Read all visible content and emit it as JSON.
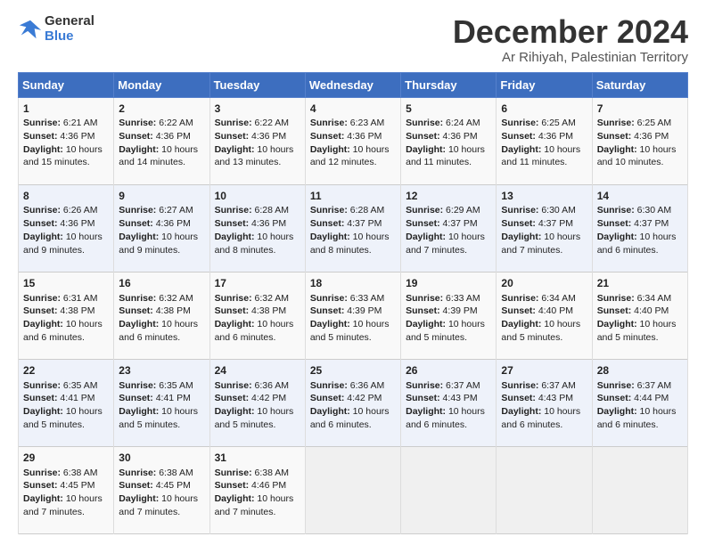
{
  "header": {
    "logo_line1": "General",
    "logo_line2": "Blue",
    "title": "December 2024",
    "subtitle": "Ar Rihiyah, Palestinian Territory"
  },
  "days_of_week": [
    "Sunday",
    "Monday",
    "Tuesday",
    "Wednesday",
    "Thursday",
    "Friday",
    "Saturday"
  ],
  "weeks": [
    [
      {
        "day": 1,
        "sunrise": "6:21 AM",
        "sunset": "4:36 PM",
        "daylight": "10 hours and 15 minutes."
      },
      {
        "day": 2,
        "sunrise": "6:22 AM",
        "sunset": "4:36 PM",
        "daylight": "10 hours and 14 minutes."
      },
      {
        "day": 3,
        "sunrise": "6:22 AM",
        "sunset": "4:36 PM",
        "daylight": "10 hours and 13 minutes."
      },
      {
        "day": 4,
        "sunrise": "6:23 AM",
        "sunset": "4:36 PM",
        "daylight": "10 hours and 12 minutes."
      },
      {
        "day": 5,
        "sunrise": "6:24 AM",
        "sunset": "4:36 PM",
        "daylight": "10 hours and 11 minutes."
      },
      {
        "day": 6,
        "sunrise": "6:25 AM",
        "sunset": "4:36 PM",
        "daylight": "10 hours and 11 minutes."
      },
      {
        "day": 7,
        "sunrise": "6:25 AM",
        "sunset": "4:36 PM",
        "daylight": "10 hours and 10 minutes."
      }
    ],
    [
      {
        "day": 8,
        "sunrise": "6:26 AM",
        "sunset": "4:36 PM",
        "daylight": "10 hours and 9 minutes."
      },
      {
        "day": 9,
        "sunrise": "6:27 AM",
        "sunset": "4:36 PM",
        "daylight": "10 hours and 9 minutes."
      },
      {
        "day": 10,
        "sunrise": "6:28 AM",
        "sunset": "4:36 PM",
        "daylight": "10 hours and 8 minutes."
      },
      {
        "day": 11,
        "sunrise": "6:28 AM",
        "sunset": "4:37 PM",
        "daylight": "10 hours and 8 minutes."
      },
      {
        "day": 12,
        "sunrise": "6:29 AM",
        "sunset": "4:37 PM",
        "daylight": "10 hours and 7 minutes."
      },
      {
        "day": 13,
        "sunrise": "6:30 AM",
        "sunset": "4:37 PM",
        "daylight": "10 hours and 7 minutes."
      },
      {
        "day": 14,
        "sunrise": "6:30 AM",
        "sunset": "4:37 PM",
        "daylight": "10 hours and 6 minutes."
      }
    ],
    [
      {
        "day": 15,
        "sunrise": "6:31 AM",
        "sunset": "4:38 PM",
        "daylight": "10 hours and 6 minutes."
      },
      {
        "day": 16,
        "sunrise": "6:32 AM",
        "sunset": "4:38 PM",
        "daylight": "10 hours and 6 minutes."
      },
      {
        "day": 17,
        "sunrise": "6:32 AM",
        "sunset": "4:38 PM",
        "daylight": "10 hours and 6 minutes."
      },
      {
        "day": 18,
        "sunrise": "6:33 AM",
        "sunset": "4:39 PM",
        "daylight": "10 hours and 5 minutes."
      },
      {
        "day": 19,
        "sunrise": "6:33 AM",
        "sunset": "4:39 PM",
        "daylight": "10 hours and 5 minutes."
      },
      {
        "day": 20,
        "sunrise": "6:34 AM",
        "sunset": "4:40 PM",
        "daylight": "10 hours and 5 minutes."
      },
      {
        "day": 21,
        "sunrise": "6:34 AM",
        "sunset": "4:40 PM",
        "daylight": "10 hours and 5 minutes."
      }
    ],
    [
      {
        "day": 22,
        "sunrise": "6:35 AM",
        "sunset": "4:41 PM",
        "daylight": "10 hours and 5 minutes."
      },
      {
        "day": 23,
        "sunrise": "6:35 AM",
        "sunset": "4:41 PM",
        "daylight": "10 hours and 5 minutes."
      },
      {
        "day": 24,
        "sunrise": "6:36 AM",
        "sunset": "4:42 PM",
        "daylight": "10 hours and 5 minutes."
      },
      {
        "day": 25,
        "sunrise": "6:36 AM",
        "sunset": "4:42 PM",
        "daylight": "10 hours and 6 minutes."
      },
      {
        "day": 26,
        "sunrise": "6:37 AM",
        "sunset": "4:43 PM",
        "daylight": "10 hours and 6 minutes."
      },
      {
        "day": 27,
        "sunrise": "6:37 AM",
        "sunset": "4:43 PM",
        "daylight": "10 hours and 6 minutes."
      },
      {
        "day": 28,
        "sunrise": "6:37 AM",
        "sunset": "4:44 PM",
        "daylight": "10 hours and 6 minutes."
      }
    ],
    [
      {
        "day": 29,
        "sunrise": "6:38 AM",
        "sunset": "4:45 PM",
        "daylight": "10 hours and 7 minutes."
      },
      {
        "day": 30,
        "sunrise": "6:38 AM",
        "sunset": "4:45 PM",
        "daylight": "10 hours and 7 minutes."
      },
      {
        "day": 31,
        "sunrise": "6:38 AM",
        "sunset": "4:46 PM",
        "daylight": "10 hours and 7 minutes."
      },
      null,
      null,
      null,
      null
    ]
  ],
  "labels": {
    "sunrise": "Sunrise:",
    "sunset": "Sunset:",
    "daylight": "Daylight:"
  }
}
